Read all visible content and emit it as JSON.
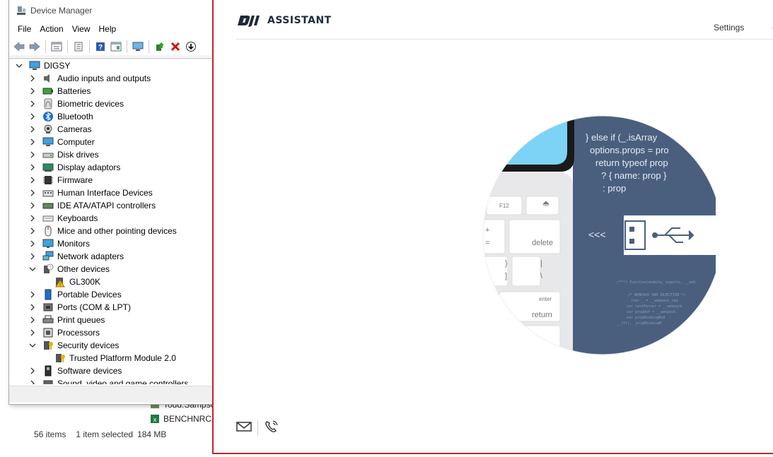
{
  "explorer": {
    "rows": [
      {
        "label": "Todd.Sampso"
      },
      {
        "label": "BENCHNRC-"
      }
    ],
    "status": {
      "items": "56 items",
      "selected": "1 item selected",
      "size": "184 MB"
    }
  },
  "device_manager": {
    "title": "Device Manager",
    "menu": [
      "File",
      "Action",
      "View",
      "Help"
    ],
    "toolbar": [
      "back-icon",
      "forward-icon",
      "show-hide-icon",
      "properties-icon",
      "help-icon",
      "action-icon",
      "scan-icon",
      "update-driver-icon",
      "uninstall-icon",
      "install-icon"
    ],
    "tree": {
      "root": "DIGSY",
      "categories": [
        {
          "label": "Audio inputs and outputs",
          "icon": "speaker-icon",
          "expanded": false
        },
        {
          "label": "Batteries",
          "icon": "battery-icon",
          "expanded": false
        },
        {
          "label": "Biometric devices",
          "icon": "fingerprint-icon",
          "expanded": false
        },
        {
          "label": "Bluetooth",
          "icon": "bluetooth-icon",
          "expanded": false
        },
        {
          "label": "Cameras",
          "icon": "camera-icon",
          "expanded": false
        },
        {
          "label": "Computer",
          "icon": "computer-icon",
          "expanded": false
        },
        {
          "label": "Disk drives",
          "icon": "disk-icon",
          "expanded": false
        },
        {
          "label": "Display adaptors",
          "icon": "display-icon",
          "expanded": false
        },
        {
          "label": "Firmware",
          "icon": "chip-icon",
          "expanded": false
        },
        {
          "label": "Human Interface Devices",
          "icon": "hid-icon",
          "expanded": false
        },
        {
          "label": "IDE ATA/ATAPI controllers",
          "icon": "ide-icon",
          "expanded": false
        },
        {
          "label": "Keyboards",
          "icon": "keyboard-icon",
          "expanded": false
        },
        {
          "label": "Mice and other pointing devices",
          "icon": "mouse-icon",
          "expanded": false
        },
        {
          "label": "Monitors",
          "icon": "monitor-icon",
          "expanded": false
        },
        {
          "label": "Network adapters",
          "icon": "network-icon",
          "expanded": false
        },
        {
          "label": "Other devices",
          "icon": "unknown-device-icon",
          "expanded": true,
          "children": [
            {
              "label": "GL300K",
              "icon": "warning-device-icon"
            }
          ]
        },
        {
          "label": "Portable Devices",
          "icon": "portable-icon",
          "expanded": false
        },
        {
          "label": "Ports (COM & LPT)",
          "icon": "port-icon",
          "expanded": false
        },
        {
          "label": "Print queues",
          "icon": "printer-icon",
          "expanded": false
        },
        {
          "label": "Processors",
          "icon": "processor-icon",
          "expanded": false
        },
        {
          "label": "Security devices",
          "icon": "security-icon",
          "expanded": true,
          "children": [
            {
              "label": "Trusted Platform Module 2.0",
              "icon": "tpm-icon"
            }
          ]
        },
        {
          "label": "Software devices",
          "icon": "software-icon",
          "expanded": false
        },
        {
          "label": "Sound, video and game controllers",
          "icon": "sound-icon",
          "expanded": false
        }
      ]
    }
  },
  "dji": {
    "logo_text": "ASSISTANT",
    "settings_label": "Settings",
    "more_label": "(",
    "hero": {
      "code_lines": [
        "} else if (_.isArray",
        "options.props = pro",
        "return typeof prop",
        "? { name: prop }",
        ": prop"
      ],
      "key_labels": [
        "F12",
        "+",
        "=",
        "delete",
        "}",
        "]",
        "|",
        "\\",
        "enter",
        "return"
      ],
      "arrows": "<<<"
    },
    "footer": [
      "mail-icon",
      "phone-icon"
    ]
  },
  "colors": {
    "dji_border": "#c0252b",
    "hero_blue": "#4a5f7e",
    "hero_screen": "#7dd3f5"
  }
}
